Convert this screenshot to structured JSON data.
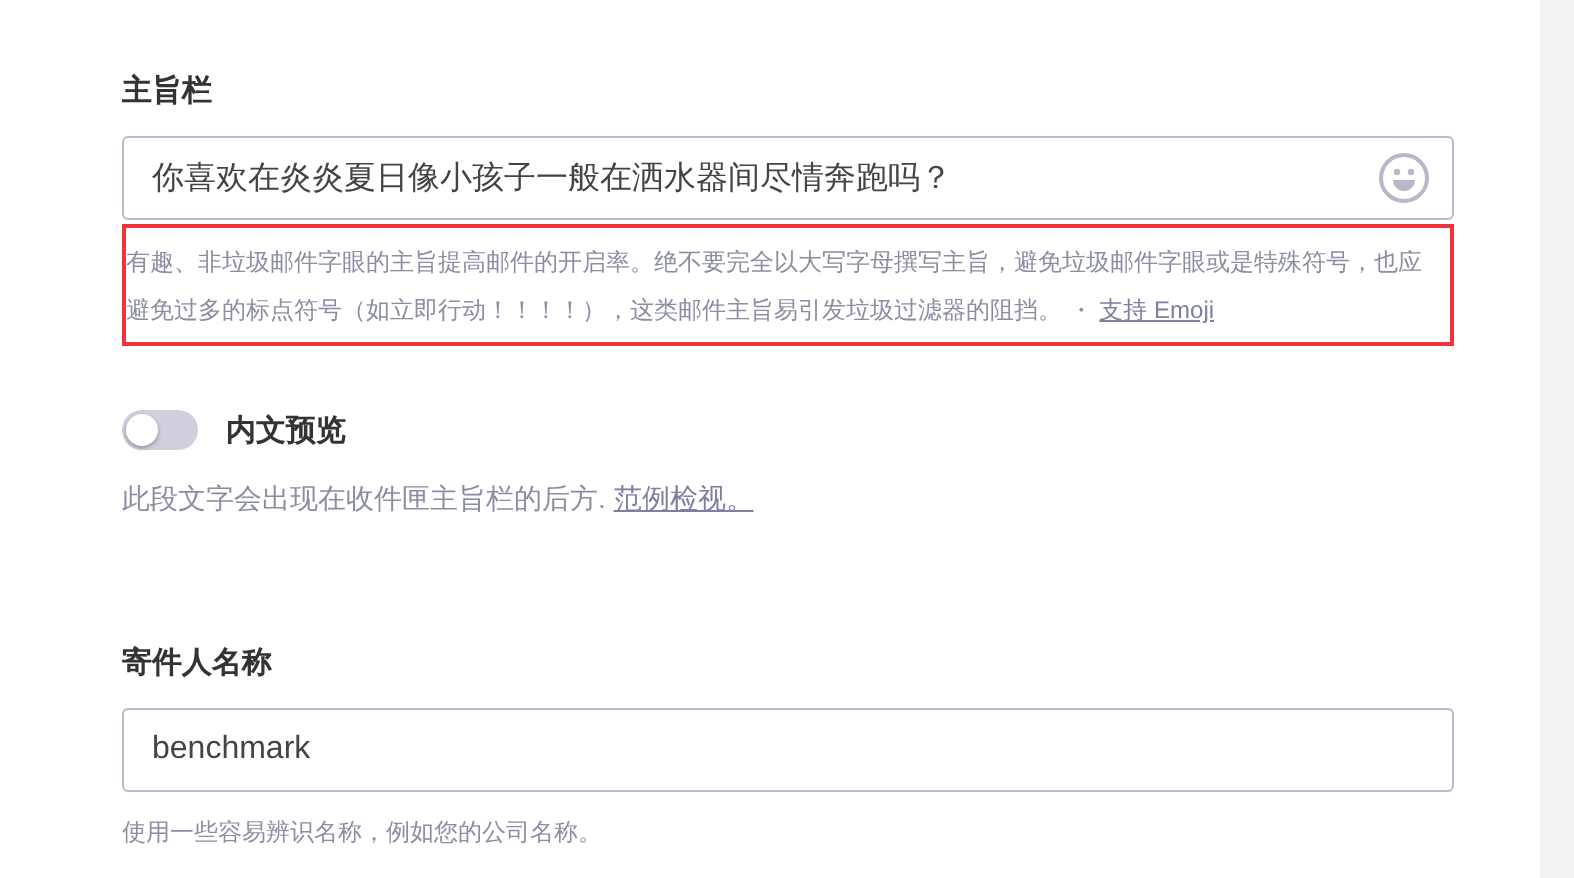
{
  "subject": {
    "label": "主旨栏",
    "value": "你喜欢在炎炎夏日像小孩子一般在洒水器间尽情奔跑吗？",
    "help": "有趣、非垃圾邮件字眼的主旨提高邮件的开启率。绝不要完全以大写字母撰写主旨，避免垃圾邮件字眼或是特殊符号，也应避免过多的标点符号（如立即行动！！！！），这类邮件主旨易引发垃圾过滤器的阻挡。 ・",
    "help_link": "支持 Emoji"
  },
  "preview": {
    "label": "内文预览",
    "on": false,
    "help": "此段文字会出现在收件匣主旨栏的后方.",
    "help_link": "范例检视。"
  },
  "sender": {
    "label": "寄件人名称",
    "value": "benchmark",
    "help": "使用一些容易辨识名称，例如您的公司名称。"
  }
}
